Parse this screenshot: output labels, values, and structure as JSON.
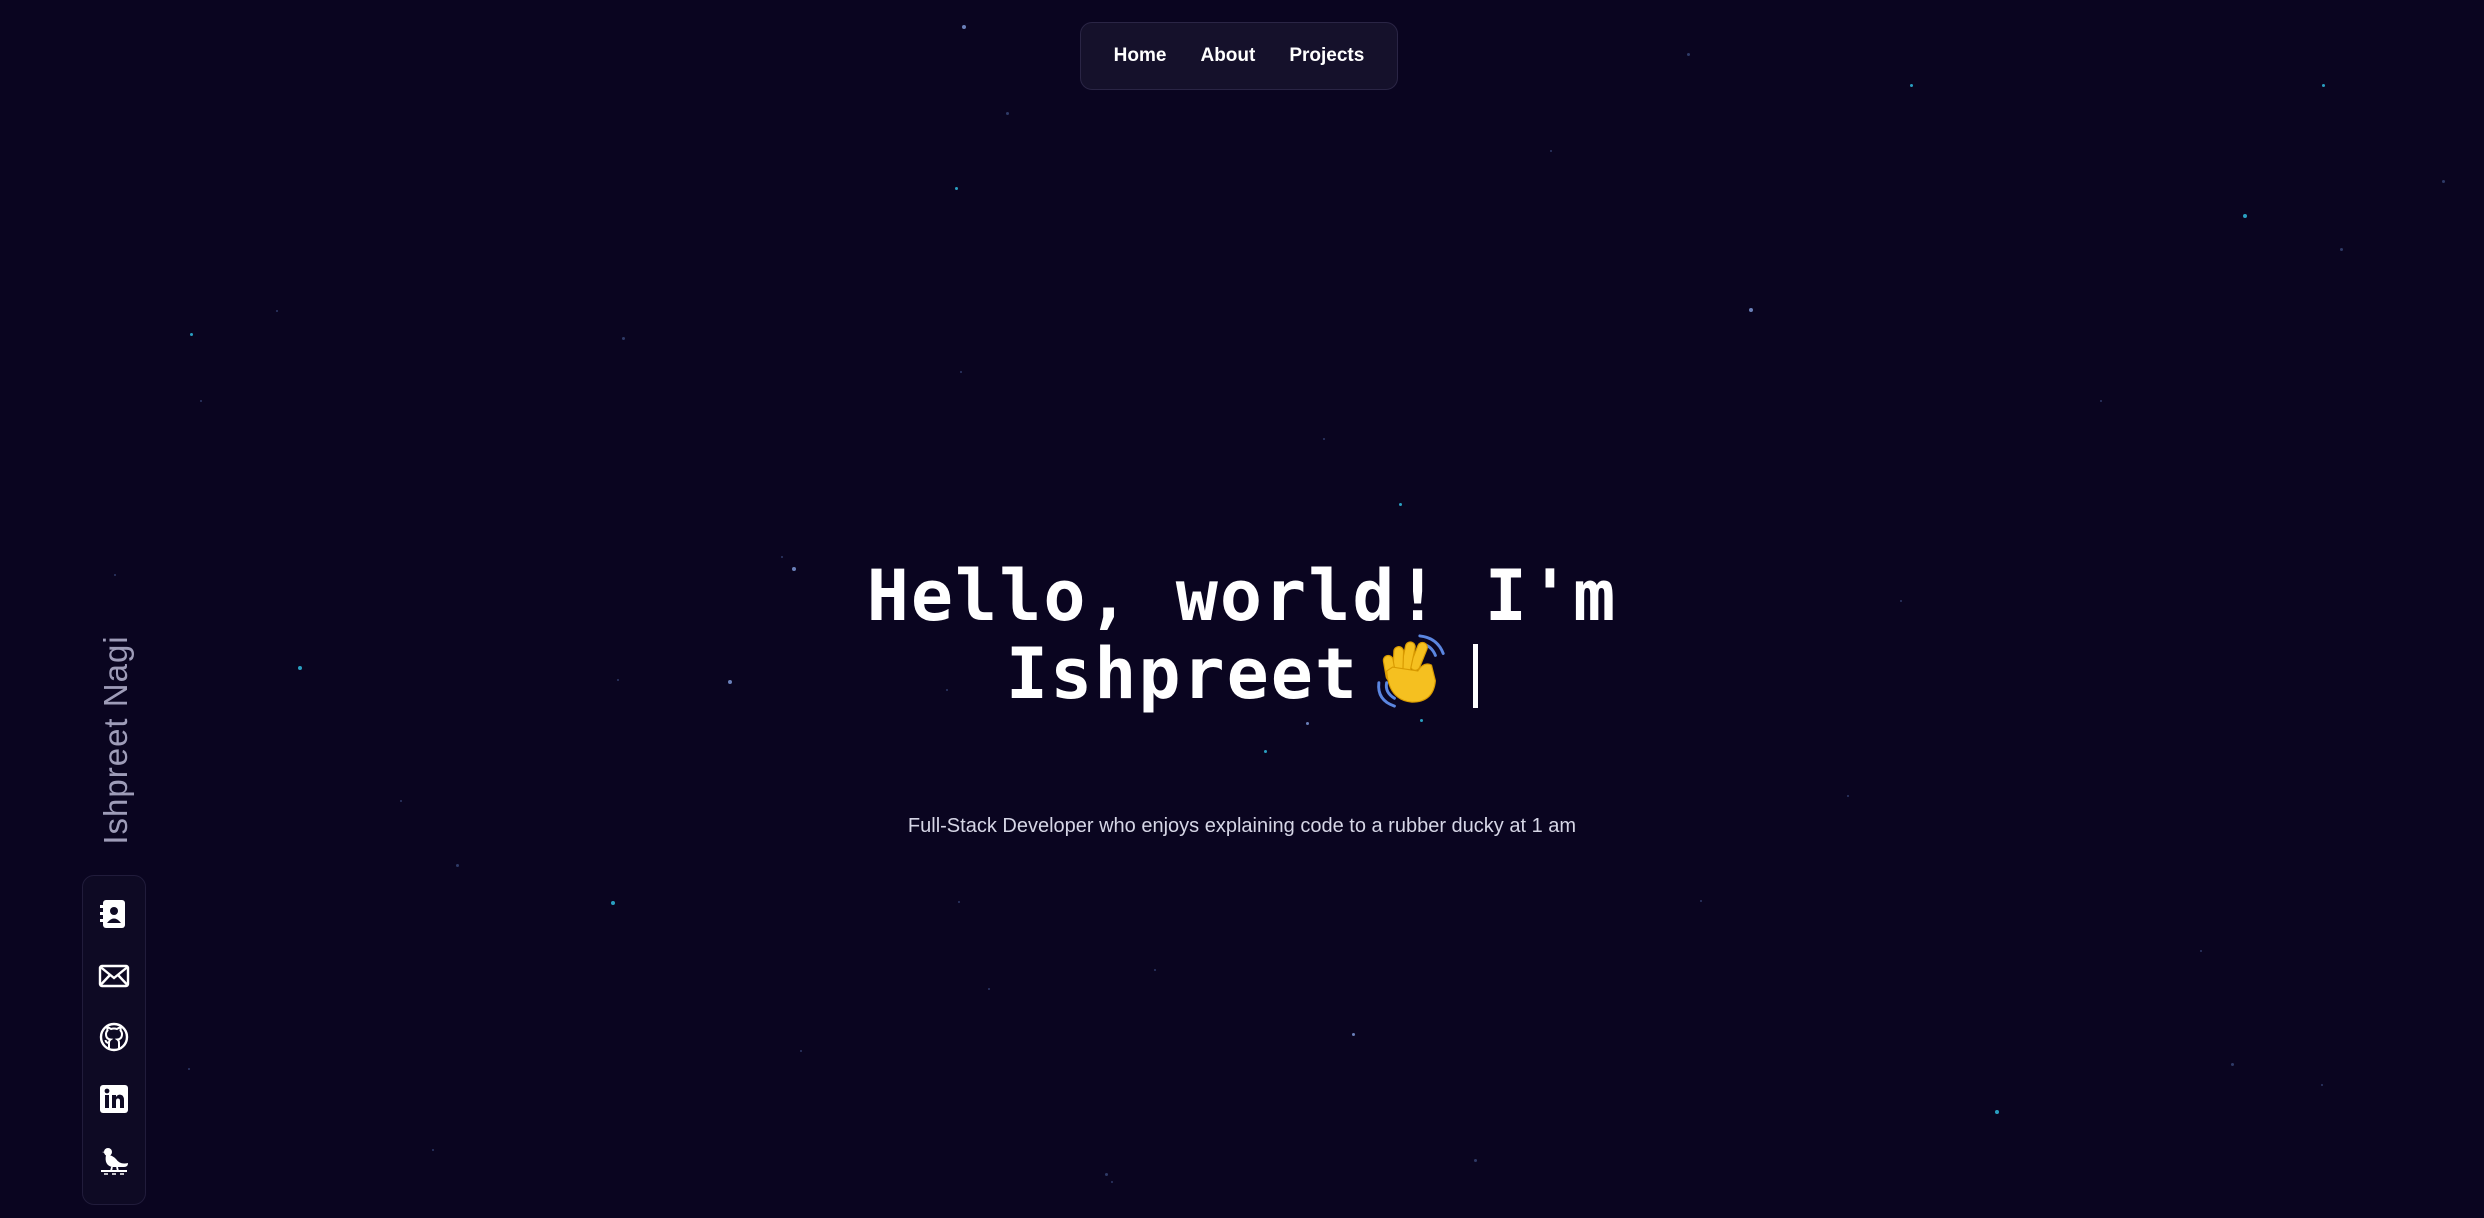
{
  "nav": {
    "items": [
      {
        "label": "Home"
      },
      {
        "label": "About"
      },
      {
        "label": "Projects"
      }
    ]
  },
  "hero": {
    "line1": "Hello, world! I'm",
    "line2": "Ishpreet",
    "subtitle": "Full-Stack Developer who enjoys explaining code to a rubber ducky at 1 am"
  },
  "sidebar": {
    "name": "Ishpreet Nagi",
    "socials": [
      {
        "icon": "contact-card-icon"
      },
      {
        "icon": "mail-icon"
      },
      {
        "icon": "github-icon"
      },
      {
        "icon": "linkedin-icon"
      },
      {
        "icon": "bird-icon"
      }
    ]
  },
  "colors": {
    "background": "#0a0520",
    "text": "#ffffff",
    "name": "#9e9cb8",
    "nav_bg": "#15112b"
  }
}
